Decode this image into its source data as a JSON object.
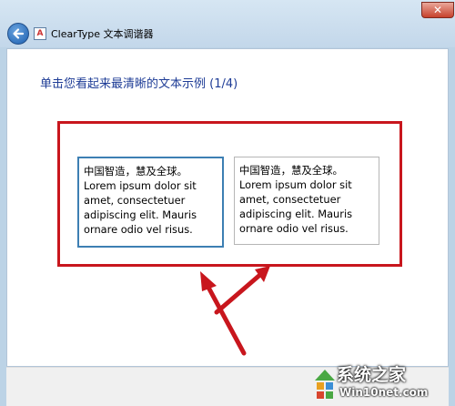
{
  "window": {
    "title": "ClearType 文本调谐器",
    "close_label": "✕",
    "app_icon_glyph": "A"
  },
  "page": {
    "heading": "单击您看起来最清晰的文本示例 (1/4)"
  },
  "samples": [
    {
      "lines": [
        "中国智造，慧及全球。",
        "Lorem ipsum dolor sit",
        "amet, consectetuer",
        "adipiscing elit. Mauris",
        "ornare odio vel risus."
      ],
      "selected": true
    },
    {
      "lines": [
        "中国智造，慧及全球。",
        "Lorem ipsum dolor sit",
        "amet, consectetuer",
        "adipiscing elit. Mauris",
        "ornare odio vel risus."
      ],
      "selected": false
    }
  ],
  "watermark": {
    "text1": "系统之家",
    "text2": "Win10net.com"
  },
  "colors": {
    "annotation_red": "#c8161d",
    "heading_blue": "#1e3c96",
    "selected_border": "#3d7fb3"
  },
  "icons": {
    "back": "back-arrow-icon",
    "close": "close-icon",
    "app": "cleartype-icon"
  }
}
